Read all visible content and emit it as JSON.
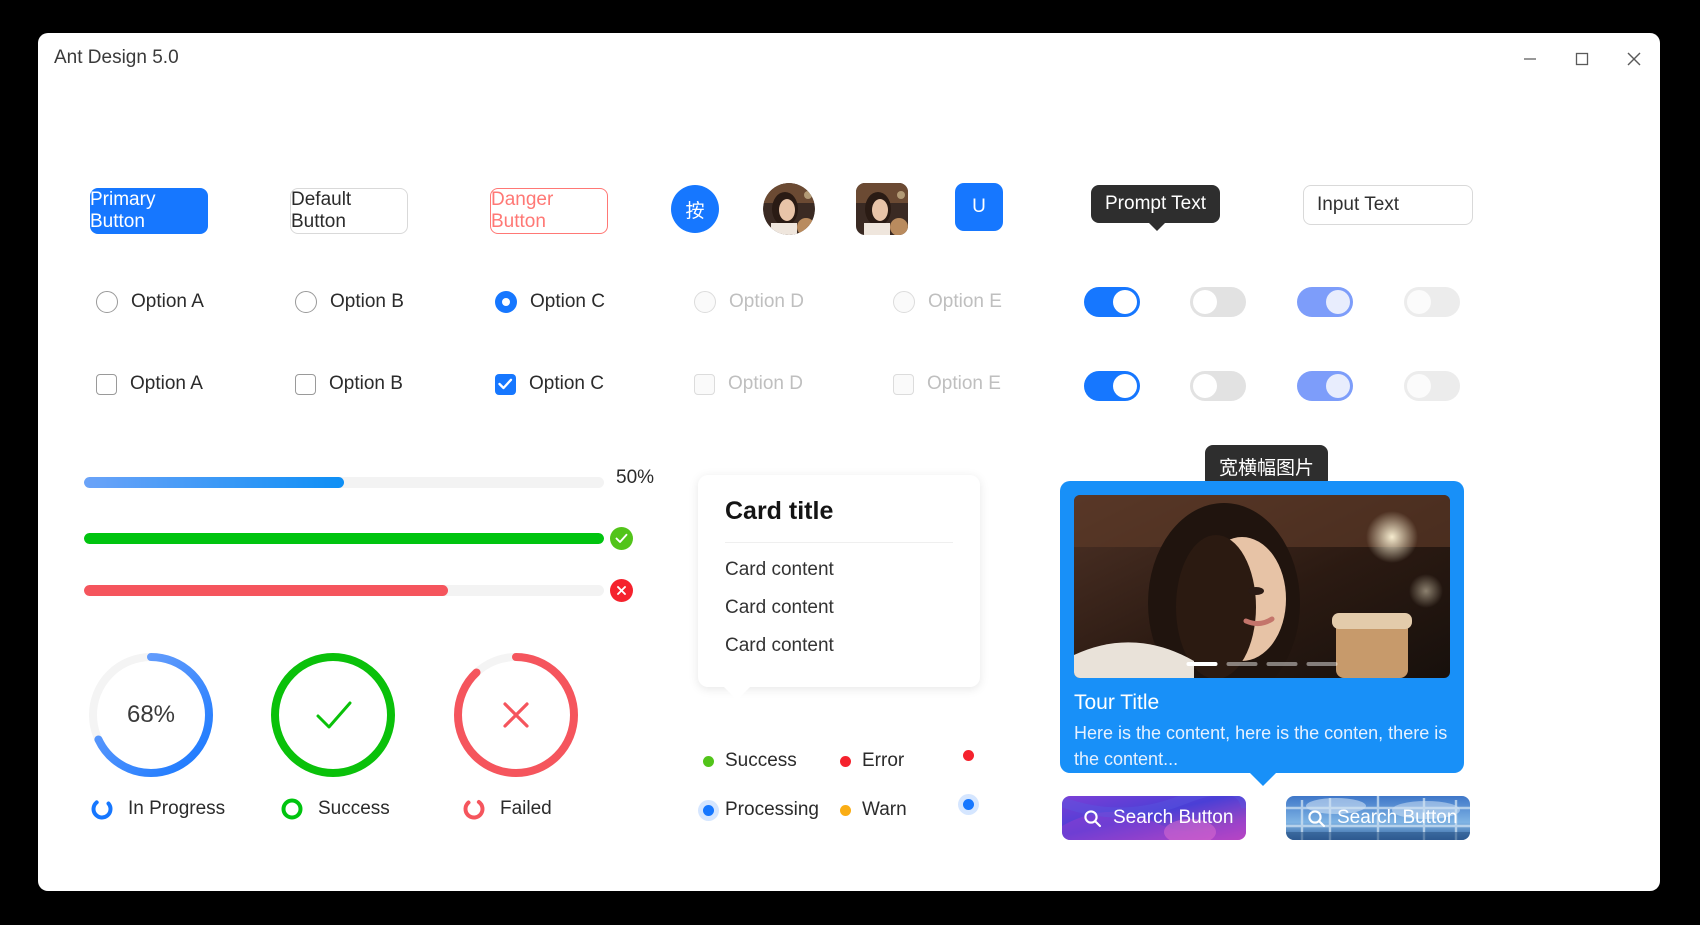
{
  "window": {
    "title": "Ant Design 5.0",
    "controls": [
      {
        "name": "minimize",
        "glyph": "minimize-icon"
      },
      {
        "name": "maximize",
        "glyph": "maximize-icon"
      },
      {
        "name": "close",
        "glyph": "close-icon"
      }
    ]
  },
  "buttons": {
    "primary": "Primary Button",
    "default": "Default Button",
    "danger": "Danger Button"
  },
  "avatars": {
    "text_cn": "按",
    "photo_round": "user-photo",
    "photo_square": "user-photo",
    "letter": "U"
  },
  "tooltip": {
    "text": "Prompt Text"
  },
  "input": {
    "value": "Input Text",
    "placeholder": "Input Text"
  },
  "radios": [
    {
      "label": "Option A",
      "checked": false,
      "disabled": false
    },
    {
      "label": "Option B",
      "checked": false,
      "disabled": false
    },
    {
      "label": "Option C",
      "checked": true,
      "disabled": false
    },
    {
      "label": "Option D",
      "checked": false,
      "disabled": true
    },
    {
      "label": "Option E",
      "checked": false,
      "disabled": true
    }
  ],
  "checkboxes": [
    {
      "label": "Option A",
      "checked": false,
      "disabled": false
    },
    {
      "label": "Option B",
      "checked": false,
      "disabled": false
    },
    {
      "label": "Option C",
      "checked": true,
      "disabled": false
    },
    {
      "label": "Option D",
      "checked": false,
      "disabled": true
    },
    {
      "label": "Option E",
      "checked": false,
      "disabled": true
    }
  ],
  "switches_row1": [
    {
      "on": true,
      "disabled": false
    },
    {
      "on": false,
      "disabled": false
    },
    {
      "on": true,
      "disabled": true
    },
    {
      "on": false,
      "disabled": true
    }
  ],
  "switches_row2": [
    {
      "on": true,
      "disabled": false
    },
    {
      "on": false,
      "disabled": false
    },
    {
      "on": true,
      "disabled": true
    },
    {
      "on": false,
      "disabled": true
    }
  ],
  "progress": {
    "bars": [
      {
        "percent": 50,
        "label": "50%",
        "status": "active",
        "color": "#1677ff"
      },
      {
        "percent": 100,
        "label": "",
        "status": "success",
        "color": "#00c40f"
      },
      {
        "percent": 70,
        "label": "",
        "status": "exception",
        "color": "#f5555d"
      }
    ],
    "circles": [
      {
        "percent": 68,
        "label": "68%",
        "status": "active",
        "color": "#4a84f5"
      },
      {
        "percent": 100,
        "label": "check-icon",
        "status": "success",
        "color": "#0ac10a"
      },
      {
        "percent": 88,
        "label": "close-icon",
        "status": "exception",
        "color": "#f5555d"
      }
    ]
  },
  "spinners": [
    {
      "label": "In Progress",
      "color": "#1677ff"
    },
    {
      "label": "Success",
      "color": "#00c40f"
    },
    {
      "label": "Failed",
      "color": "#f5555d"
    }
  ],
  "card": {
    "title": "Card title",
    "lines": [
      "Card content",
      "Card content",
      "Card content"
    ]
  },
  "badges": [
    {
      "label": "Success",
      "color": "#52c41a",
      "halo": false
    },
    {
      "label": "Error",
      "color": "#f5222d",
      "halo": false
    },
    {
      "label": "",
      "color": "#f5222d",
      "halo": false
    },
    {
      "label": "Processing",
      "color": "#1677ff",
      "halo": true
    },
    {
      "label": "Warn",
      "color": "#faad14",
      "halo": false
    },
    {
      "label": "",
      "color": "#1677ff",
      "halo": true
    }
  ],
  "banner_tooltip": {
    "text": "宽横幅图片"
  },
  "tour": {
    "title": "Tour Title",
    "text": "Here is the content, here is the conten, there is the content...",
    "dots": 4,
    "active_dot": 1
  },
  "search_buttons": [
    {
      "label": "Search Button",
      "theme": "purple"
    },
    {
      "label": "Search Button",
      "theme": "sky"
    }
  ],
  "colors": {
    "primary": "#1677ff",
    "success": "#00c40f",
    "error": "#f5555d",
    "warning": "#faad14",
    "tour_bg": "#1890f8"
  }
}
